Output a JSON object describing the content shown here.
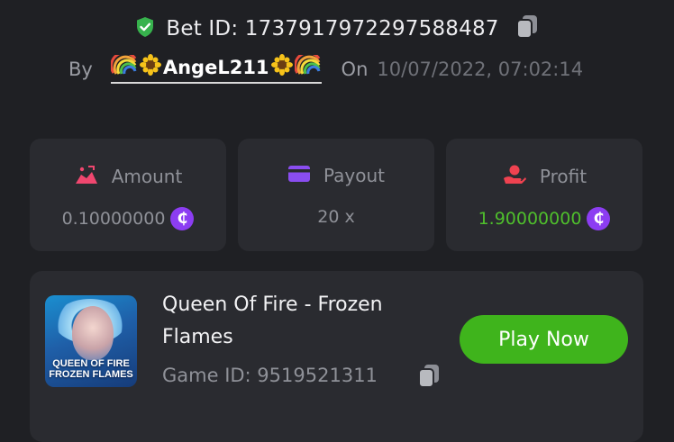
{
  "bet": {
    "label": "Bet ID: 1737917972297588487",
    "by_label": "By",
    "username": "AngeL211",
    "on_label": "On",
    "datetime": "10/07/2022, 07:02:14"
  },
  "stats": {
    "amount": {
      "title": "Amount",
      "value": "0.10000000"
    },
    "payout": {
      "title": "Payout",
      "value": "20 x"
    },
    "profit": {
      "title": "Profit",
      "value": "1.90000000"
    },
    "coin_symbol": "₵"
  },
  "game": {
    "title": "Queen Of Fire - Frozen Flames",
    "thumbnail_text_line1": "QUEEN OF FIRE",
    "thumbnail_text_line2": "FROZEN FLAMES",
    "id_label": "Game ID: 9519521311",
    "play_label": "Play Now"
  },
  "colors": {
    "background": "#1f2024",
    "card": "#2a2b30",
    "accent_green": "#3fb41c",
    "profit_green": "#4fbf2c",
    "coin_purple": "#8c3df2",
    "amount_icon": "#f0476f",
    "payout_icon": "#8a4df0",
    "profit_icon": "#ef4250",
    "shield_green": "#37b24d"
  },
  "icons": [
    "shield-check-icon",
    "copy-icon",
    "rainbow-icon",
    "sunflower-icon",
    "amount-icon",
    "payout-card-icon",
    "profit-hand-icon",
    "coin-icon"
  ]
}
